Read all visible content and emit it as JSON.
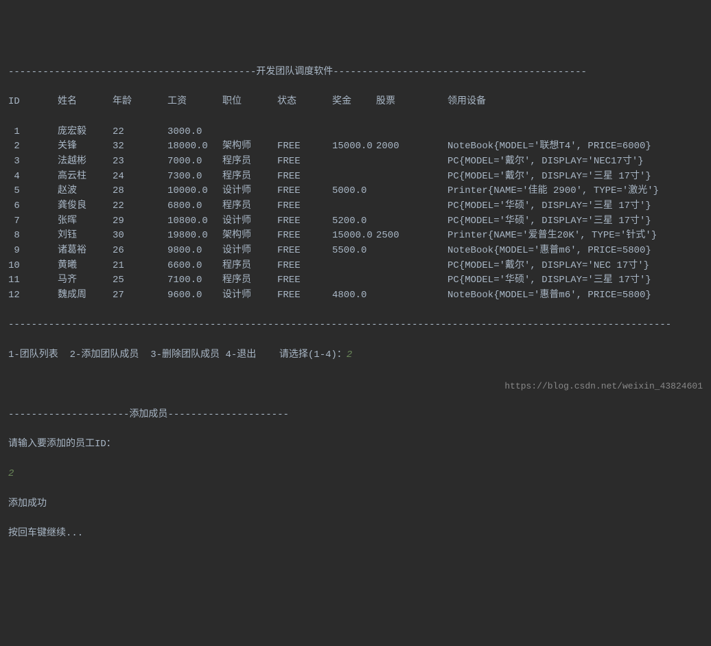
{
  "title": "开发团队调度软件",
  "title_dashes_left": "-------------------------------------------",
  "title_dashes_right": "--------------------------------------------",
  "headers": {
    "id": "ID",
    "name": "姓名",
    "age": "年龄",
    "salary": "工资",
    "position": "职位",
    "status": "状态",
    "bonus": "奖金",
    "stock": "股票",
    "equipment": "领用设备"
  },
  "rows": [
    {
      "id": "1",
      "name": "庞宏毅",
      "age": "22",
      "salary": "3000.0",
      "position": "",
      "status": "",
      "bonus": "",
      "stock": "",
      "equipment": ""
    },
    {
      "id": "2",
      "name": "关锋",
      "age": "32",
      "salary": "18000.0",
      "position": "架构师",
      "status": "FREE",
      "bonus": "15000.0",
      "stock": "2000",
      "equipment": "NoteBook{MODEL='联想T4', PRICE=6000}"
    },
    {
      "id": "3",
      "name": "法越彬",
      "age": "23",
      "salary": "7000.0",
      "position": "程序员",
      "status": "FREE",
      "bonus": "",
      "stock": "",
      "equipment": "PC{MODEL='戴尔', DISPLAY='NEC17寸'}"
    },
    {
      "id": "4",
      "name": "高云柱",
      "age": "24",
      "salary": "7300.0",
      "position": "程序员",
      "status": "FREE",
      "bonus": "",
      "stock": "",
      "equipment": "PC{MODEL='戴尔', DISPLAY='三星 17寸'}"
    },
    {
      "id": "5",
      "name": "赵波",
      "age": "28",
      "salary": "10000.0",
      "position": "设计师",
      "status": "FREE",
      "bonus": "5000.0",
      "stock": "",
      "equipment": "Printer{NAME='佳能 2900', TYPE='激光'}"
    },
    {
      "id": "6",
      "name": "龚俊良",
      "age": "22",
      "salary": "6800.0",
      "position": "程序员",
      "status": "FREE",
      "bonus": "",
      "stock": "",
      "equipment": "PC{MODEL='华硕', DISPLAY='三星 17寸'}"
    },
    {
      "id": "7",
      "name": "张晖",
      "age": "29",
      "salary": "10800.0",
      "position": "设计师",
      "status": "FREE",
      "bonus": "5200.0",
      "stock": "",
      "equipment": "PC{MODEL='华硕', DISPLAY='三星 17寸'}"
    },
    {
      "id": "8",
      "name": "刘钰",
      "age": "30",
      "salary": "19800.0",
      "position": "架构师",
      "status": "FREE",
      "bonus": "15000.0",
      "stock": "2500",
      "equipment": "Printer{NAME='爱普生20K', TYPE='针式'}"
    },
    {
      "id": "9",
      "name": "诸葛裕",
      "age": "26",
      "salary": "9800.0",
      "position": "设计师",
      "status": "FREE",
      "bonus": "5500.0",
      "stock": "",
      "equipment": "NoteBook{MODEL='惠普m6', PRICE=5800}"
    },
    {
      "id": "10",
      "name": "黄曦",
      "age": "21",
      "salary": "6600.0",
      "position": "程序员",
      "status": "FREE",
      "bonus": "",
      "stock": "",
      "equipment": "PC{MODEL='戴尔', DISPLAY='NEC 17寸'}"
    },
    {
      "id": "11",
      "name": "马齐",
      "age": "25",
      "salary": "7100.0",
      "position": "程序员",
      "status": "FREE",
      "bonus": "",
      "stock": "",
      "equipment": "PC{MODEL='华硕', DISPLAY='三星 17寸'}"
    },
    {
      "id": "12",
      "name": "魏成周",
      "age": "27",
      "salary": "9600.0",
      "position": "设计师",
      "status": "FREE",
      "bonus": "4800.0",
      "stock": "",
      "equipment": "NoteBook{MODEL='惠普m6', PRICE=5800}"
    }
  ],
  "divider": "-------------------------------------------------------------------------------------------------------------------",
  "menu": {
    "opt1": "1-团队列表",
    "opt2": "2-添加团队成员",
    "opt3": "3-删除团队成员",
    "opt4": "4-退出",
    "prompt": "请选择(1-4)：",
    "input": "2"
  },
  "add_section": {
    "dashes_left": "---------------------",
    "title": "添加成员",
    "dashes_right": "---------------------",
    "prompt": "请输入要添加的员工ID：",
    "input": "2",
    "success": "添加成功",
    "continue": "按回车键继续..."
  },
  "watermark": "https://blog.csdn.net/weixin_43824601"
}
